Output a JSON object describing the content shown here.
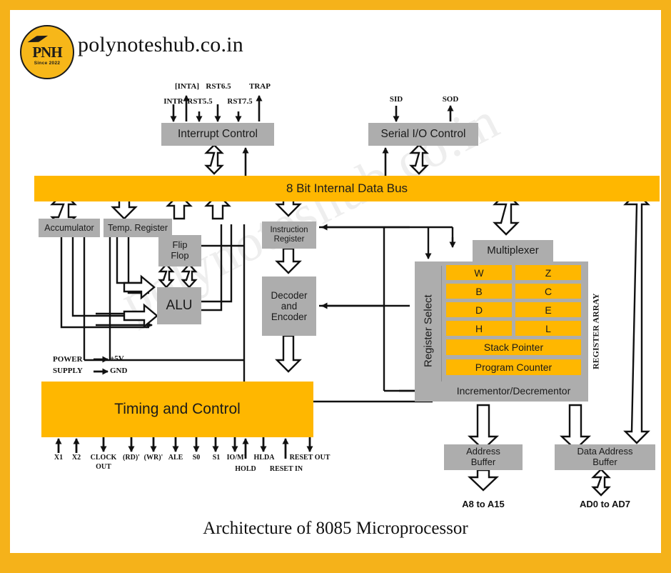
{
  "brand": {
    "logo_text": "PNH",
    "logo_since": "Since 2022",
    "site_name": "polynoteshub.co.in",
    "watermark": "polynoteshub.co.in",
    "accent_color": "#f5b21a",
    "block_gray": "#adadad",
    "block_yellow": "#ffb700"
  },
  "caption": "Architecture of 8085 Microprocessor",
  "diagram": {
    "type": "block-diagram",
    "title": "Architecture of 8085 Microprocessor",
    "blocks": {
      "interrupt_control": "Interrupt Control",
      "serial_io_control": "Serial I/O Control",
      "data_bus": "8 Bit Internal Data Bus",
      "accumulator": "Accumulator",
      "temp_register": "Temp. Register",
      "flip_flop": "Flip\nFlop",
      "flip_flop_line1": "Flip",
      "flip_flop_line2": "Flop",
      "alu": "ALU",
      "instruction_register_line1": "Instruction",
      "instruction_register_line2": "Register",
      "decoder_line1": "Decoder",
      "decoder_line2": "and",
      "decoder_line3": "Encoder",
      "timing_and_control": "Timing and Control",
      "multiplexer": "Multiplexer",
      "register_select": "Register Select",
      "register_array_label": "REGISTER ARRAY",
      "incrementor_decrementor": "Incrementor/Decrementor",
      "address_buffer_line1": "Address",
      "address_buffer_line2": "Buffer",
      "data_address_buffer_line1": "Data Address",
      "data_address_buffer_line2": "Buffer"
    },
    "registers": [
      [
        "W",
        "Z"
      ],
      [
        "B",
        "C"
      ],
      [
        "D",
        "E"
      ],
      [
        "H",
        "L"
      ]
    ],
    "register_wide": [
      "Stack Pointer",
      "Program Counter"
    ],
    "interrupt_signals_top": [
      "[INTA]",
      "RST6.5",
      "TRAP"
    ],
    "interrupt_signals_bottom": [
      "INTR",
      "RST5.5",
      "RST7.5"
    ],
    "serial_signals": [
      "SID",
      "SOD"
    ],
    "power_supply": {
      "line1": "POWER",
      "line2": "SUPPLY",
      "rail1": "+5V",
      "rail2": "GND"
    },
    "control_signals_row1": [
      "X1",
      "X2",
      "CLOCK",
      "(RD)'",
      "(WR)'",
      "ALE",
      "S0",
      "S1",
      "IO/M'",
      "HLDA",
      "RESET OUT"
    ],
    "control_signals_row2": [
      "OUT",
      "HOLD",
      "RESET IN"
    ],
    "control_signals": [
      {
        "label": "X1",
        "dir": "in"
      },
      {
        "label": "X2",
        "dir": "in"
      },
      {
        "label": "CLOCK",
        "label2": "OUT",
        "dir": "out"
      },
      {
        "label": "(RD)'",
        "dir": "out"
      },
      {
        "label": "(WR)'",
        "dir": "out"
      },
      {
        "label": "ALE",
        "dir": "out"
      },
      {
        "label": "S0",
        "dir": "out"
      },
      {
        "label": "S1",
        "dir": "out"
      },
      {
        "label": "IO/M'",
        "dir": "out"
      },
      {
        "label": "HOLD",
        "dir": "in"
      },
      {
        "label": "HLDA",
        "dir": "out"
      },
      {
        "label": "RESET IN",
        "dir": "in"
      },
      {
        "label": "RESET OUT",
        "dir": "out"
      }
    ],
    "bus_outputs": {
      "address": "A8 to A15",
      "data_address": "AD0 to AD7"
    }
  }
}
